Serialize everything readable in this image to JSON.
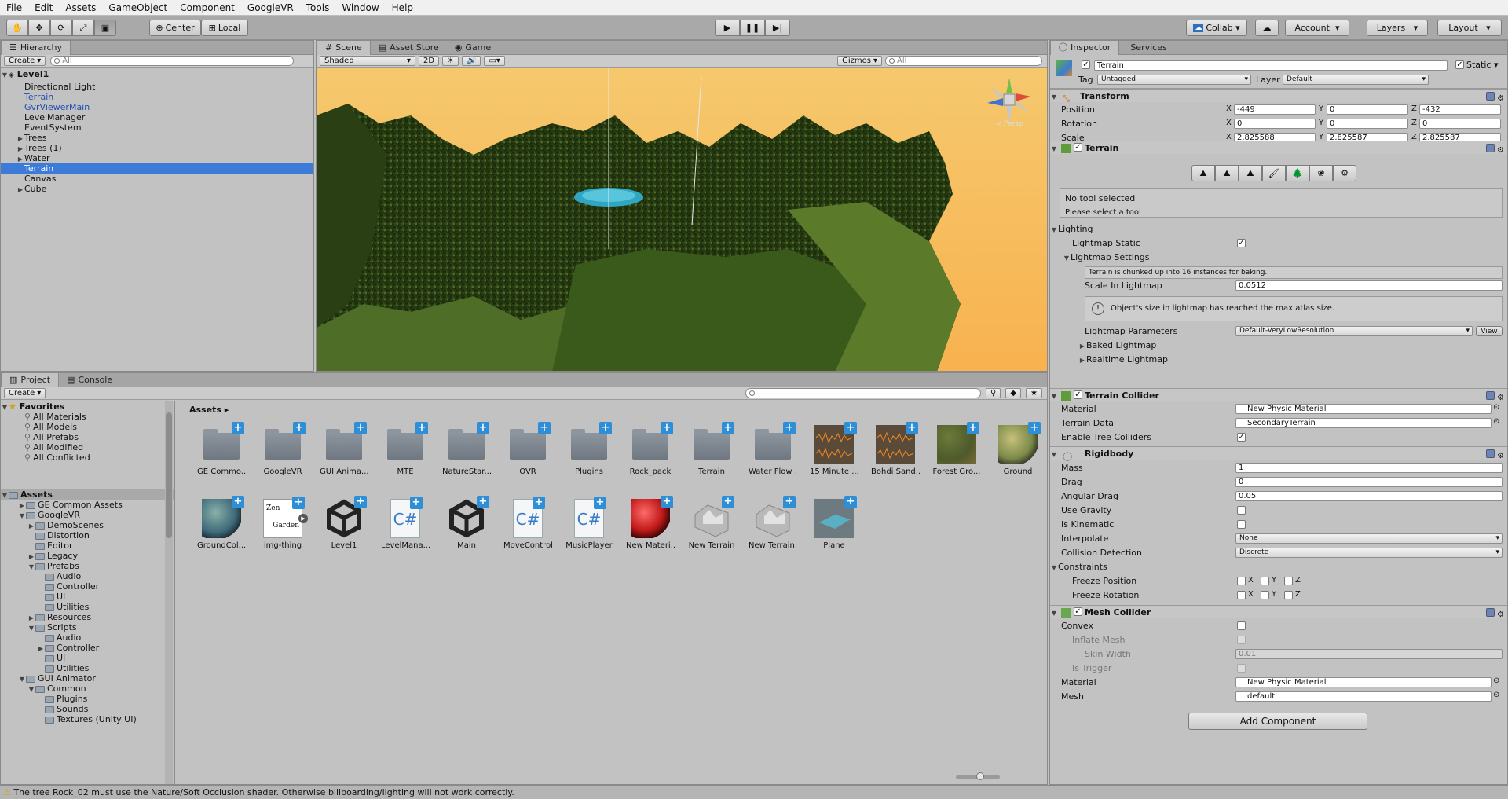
{
  "menu": [
    "File",
    "Edit",
    "Assets",
    "GameObject",
    "Component",
    "GoogleVR",
    "Tools",
    "Window",
    "Help"
  ],
  "toolbar": {
    "pivot_label": "Center",
    "space_label": "Local",
    "collab_label": "Collab",
    "account_label": "Account",
    "layers_label": "Layers",
    "layout_label": "Layout"
  },
  "hierarchy": {
    "tab": "Hierarchy",
    "create": "Create",
    "search_placeholder": "All",
    "scene": "Level1",
    "items": [
      {
        "label": "Directional Light",
        "indent": 1,
        "arrow": false,
        "blue": false,
        "selected": false
      },
      {
        "label": "Terrain",
        "indent": 1,
        "arrow": false,
        "blue": true,
        "selected": false
      },
      {
        "label": "GvrViewerMain",
        "indent": 1,
        "arrow": false,
        "blue": true,
        "selected": false
      },
      {
        "label": "LevelManager",
        "indent": 1,
        "arrow": false,
        "blue": false,
        "selected": false
      },
      {
        "label": "EventSystem",
        "indent": 1,
        "arrow": false,
        "blue": false,
        "selected": false
      },
      {
        "label": "Trees",
        "indent": 1,
        "arrow": true,
        "blue": false,
        "selected": false
      },
      {
        "label": "Trees (1)",
        "indent": 1,
        "arrow": true,
        "blue": false,
        "selected": false
      },
      {
        "label": "Water",
        "indent": 1,
        "arrow": true,
        "blue": false,
        "selected": false
      },
      {
        "label": "Terrain",
        "indent": 1,
        "arrow": false,
        "blue": false,
        "selected": true
      },
      {
        "label": "Canvas",
        "indent": 1,
        "arrow": false,
        "blue": false,
        "selected": false
      },
      {
        "label": "Cube",
        "indent": 1,
        "arrow": true,
        "blue": false,
        "selected": false
      }
    ]
  },
  "scene": {
    "tabs": [
      "Scene",
      "Asset Store",
      "Game"
    ],
    "shading": "Shaded",
    "mode_2d": "2D",
    "gizmos": "Gizmos",
    "search_placeholder": "All",
    "persp_label": "Persp"
  },
  "project": {
    "tabs": [
      "Project",
      "Console"
    ],
    "create": "Create",
    "favorites_title": "Favorites",
    "favorites": [
      "All Materials",
      "All Models",
      "All Prefabs",
      "All Modified",
      "All Conflicted"
    ],
    "assets_root": "Assets",
    "tree": [
      {
        "label": "GE Common Assets",
        "depth": 1,
        "arrow": "right"
      },
      {
        "label": "GoogleVR",
        "depth": 1,
        "arrow": "down"
      },
      {
        "label": "DemoScenes",
        "depth": 2,
        "arrow": "right"
      },
      {
        "label": "Distortion",
        "depth": 2,
        "arrow": ""
      },
      {
        "label": "Editor",
        "depth": 2,
        "arrow": ""
      },
      {
        "label": "Legacy",
        "depth": 2,
        "arrow": "right"
      },
      {
        "label": "Prefabs",
        "depth": 2,
        "arrow": "down"
      },
      {
        "label": "Audio",
        "depth": 3,
        "arrow": ""
      },
      {
        "label": "Controller",
        "depth": 3,
        "arrow": ""
      },
      {
        "label": "UI",
        "depth": 3,
        "arrow": ""
      },
      {
        "label": "Utilities",
        "depth": 3,
        "arrow": ""
      },
      {
        "label": "Resources",
        "depth": 2,
        "arrow": "right"
      },
      {
        "label": "Scripts",
        "depth": 2,
        "arrow": "down"
      },
      {
        "label": "Audio",
        "depth": 3,
        "arrow": ""
      },
      {
        "label": "Controller",
        "depth": 3,
        "arrow": "right"
      },
      {
        "label": "UI",
        "depth": 3,
        "arrow": ""
      },
      {
        "label": "Utilities",
        "depth": 3,
        "arrow": ""
      },
      {
        "label": "GUI Animator",
        "depth": 1,
        "arrow": "down"
      },
      {
        "label": "Common",
        "depth": 2,
        "arrow": "down"
      },
      {
        "label": "Plugins",
        "depth": 3,
        "arrow": ""
      },
      {
        "label": "Sounds",
        "depth": 3,
        "arrow": ""
      },
      {
        "label": "Textures (Unity UI)",
        "depth": 3,
        "arrow": ""
      }
    ],
    "breadcrumb": "Assets",
    "assets_row1": [
      {
        "label": "GE Commo...",
        "kind": "folder"
      },
      {
        "label": "GoogleVR",
        "kind": "folder"
      },
      {
        "label": "GUI Anima...",
        "kind": "folder"
      },
      {
        "label": "MTE",
        "kind": "folder"
      },
      {
        "label": "NatureStar...",
        "kind": "folder"
      },
      {
        "label": "OVR",
        "kind": "folder"
      },
      {
        "label": "Plugins",
        "kind": "folder"
      },
      {
        "label": "Rock_pack",
        "kind": "folder"
      },
      {
        "label": "Terrain",
        "kind": "folder"
      },
      {
        "label": "Water Flow ...",
        "kind": "folder"
      },
      {
        "label": "15 Minute ...",
        "kind": "audio"
      },
      {
        "label": "Bohdi Sand...",
        "kind": "audio"
      },
      {
        "label": "Forest Gro...",
        "kind": "texture"
      },
      {
        "label": "Ground",
        "kind": "sphere-ground"
      }
    ],
    "assets_row2": [
      {
        "label": "GroundCol...",
        "kind": "sphere-teal"
      },
      {
        "label": "img-thing",
        "kind": "image"
      },
      {
        "label": "Level1",
        "kind": "unity"
      },
      {
        "label": "LevelMana...",
        "kind": "script"
      },
      {
        "label": "Main",
        "kind": "unity"
      },
      {
        "label": "MoveControl",
        "kind": "script"
      },
      {
        "label": "MusicPlayer",
        "kind": "script"
      },
      {
        "label": "New Materi...",
        "kind": "sphere-red"
      },
      {
        "label": "New Terrain",
        "kind": "terrain"
      },
      {
        "label": "New Terrain...",
        "kind": "terrain"
      },
      {
        "label": "Plane",
        "kind": "plane"
      }
    ],
    "img_text_1": "Zen",
    "img_text_2": "Garden"
  },
  "inspector": {
    "tabs": [
      "Inspector",
      "Services"
    ],
    "object_name": "Terrain",
    "static_label": "Static",
    "tag_label": "Tag",
    "tag_value": "Untagged",
    "layer_label": "Layer",
    "layer_value": "Default",
    "transform": {
      "title": "Transform",
      "position_label": "Position",
      "position": [
        "-449",
        "0",
        "-432"
      ],
      "rotation_label": "Rotation",
      "rotation": [
        "0",
        "0",
        "0"
      ],
      "scale_label": "Scale",
      "scale": [
        "2.825588",
        "2.825587",
        "2.825587"
      ]
    },
    "terrain": {
      "title": "Terrain",
      "no_tool": "No tool selected",
      "select_tool": "Please select a tool",
      "lighting": "Lighting",
      "lightmap_static": "Lightmap Static",
      "lightmap_settings": "Lightmap Settings",
      "chunk_note": "Terrain is chunked up into 16 instances for baking.",
      "scale_in_lightmap_label": "Scale In Lightmap",
      "scale_in_lightmap": "0.0512",
      "warning": "Object's size in lightmap has reached the max atlas size.",
      "lightmap_params_label": "Lightmap Parameters",
      "lightmap_params": "Default-VeryLowResolution",
      "view_button": "View",
      "baked_lightmap": "Baked Lightmap",
      "realtime_lightmap": "Realtime Lightmap"
    },
    "terrain_collider": {
      "title": "Terrain Collider",
      "material_label": "Material",
      "material": "New Physic Material",
      "terrain_data_label": "Terrain Data",
      "terrain_data": "SecondaryTerrain",
      "enable_trees_label": "Enable Tree Colliders"
    },
    "rigidbody": {
      "title": "Rigidbody",
      "mass_label": "Mass",
      "mass": "1",
      "drag_label": "Drag",
      "drag": "0",
      "angular_drag_label": "Angular Drag",
      "angular_drag": "0.05",
      "use_gravity_label": "Use Gravity",
      "is_kinematic_label": "Is Kinematic",
      "interpolate_label": "Interpolate",
      "interpolate": "None",
      "collision_label": "Collision Detection",
      "collision": "Discrete",
      "constraints_label": "Constraints",
      "freeze_pos_label": "Freeze Position",
      "freeze_rot_label": "Freeze Rotation"
    },
    "mesh_collider": {
      "title": "Mesh Collider",
      "convex_label": "Convex",
      "inflate_label": "Inflate Mesh",
      "skin_label": "Skin Width",
      "skin": "0.01",
      "trigger_label": "Is Trigger",
      "material_label": "Material",
      "material": "New Physic Material",
      "mesh_label": "Mesh",
      "mesh": "default"
    },
    "add_component": "Add Component",
    "axes": [
      "X",
      "Y",
      "Z"
    ]
  },
  "status_message": "The tree Rock_02 must use the Nature/Soft Occlusion shader. Otherwise billboarding/lighting will not work correctly."
}
